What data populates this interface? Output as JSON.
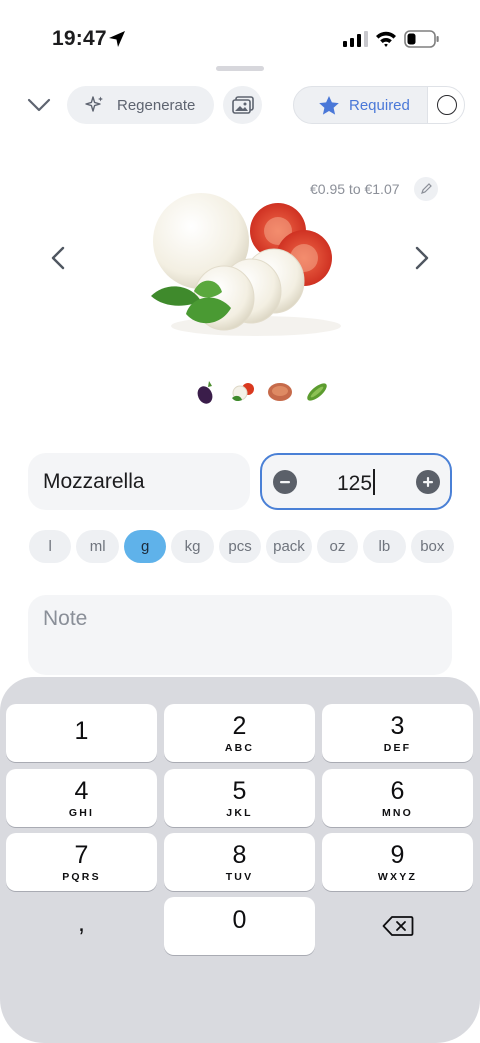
{
  "status_bar": {
    "time": "19:47"
  },
  "toolbar": {
    "regenerate_label": "Regenerate",
    "required_label": "Required"
  },
  "product": {
    "price_range": "€0.95 to €1.07",
    "name": "Mozzarella",
    "quantity": "125",
    "unit_options": [
      "l",
      "ml",
      "g",
      "kg",
      "pcs",
      "pack",
      "oz",
      "lb",
      "box"
    ],
    "selected_unit": "g",
    "note_placeholder": "Note",
    "thumbnails": [
      "eggplant",
      "mozzarella-tomato",
      "meat-patty",
      "cucumber"
    ]
  },
  "keypad": {
    "keys": [
      {
        "num": "1",
        "letters": ""
      },
      {
        "num": "2",
        "letters": "ABC"
      },
      {
        "num": "3",
        "letters": "DEF"
      },
      {
        "num": "4",
        "letters": "GHI"
      },
      {
        "num": "5",
        "letters": "JKL"
      },
      {
        "num": "6",
        "letters": "MNO"
      },
      {
        "num": "7",
        "letters": "PQRS"
      },
      {
        "num": "8",
        "letters": "TUV"
      },
      {
        "num": "9",
        "letters": "WXYZ"
      },
      {
        "num": "0",
        "letters": ""
      }
    ],
    "comma": ","
  },
  "colors": {
    "accent": "#4a80d6",
    "unit_selected": "#5fb2ea",
    "required_star": "#4a78d8",
    "field_bg": "#f4f5f7",
    "keypad_bg": "#d9dadf"
  }
}
